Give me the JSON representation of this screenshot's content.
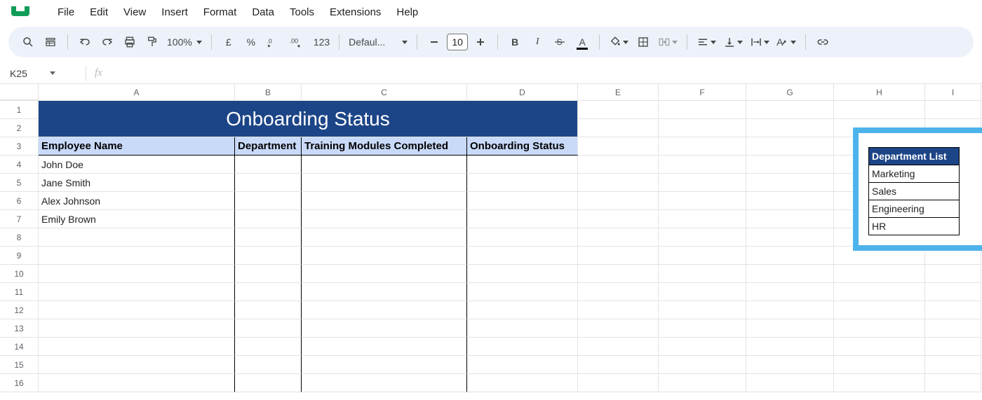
{
  "menu": {
    "items": [
      "File",
      "Edit",
      "View",
      "Insert",
      "Format",
      "Data",
      "Tools",
      "Extensions",
      "Help"
    ]
  },
  "toolbar": {
    "zoom": "100%",
    "currency": "£",
    "percent": "%",
    "dec_decrease": ".0",
    "dec_increase": ".00",
    "format_123": "123",
    "font_name": "Defaul...",
    "font_size": "10",
    "bold": "B",
    "italic": "I",
    "text_color_letter": "A",
    "text_color_drop": "A"
  },
  "name_box": {
    "ref": "K25",
    "fx_label": "fx",
    "formula": ""
  },
  "columns": [
    "A",
    "B",
    "C",
    "D",
    "E",
    "F",
    "G",
    "H",
    "I"
  ],
  "rows": [
    "1",
    "2",
    "3",
    "4",
    "5",
    "6",
    "7",
    "8",
    "9",
    "10",
    "11",
    "12",
    "13",
    "14",
    "15",
    "16"
  ],
  "sheet": {
    "title": "Onboarding Status",
    "headers": {
      "A": "Employee Name",
      "B": "Department",
      "C": "Training Modules Completed",
      "D": "Onboarding Status"
    },
    "data": [
      {
        "name": "John Doe"
      },
      {
        "name": "Jane Smith"
      },
      {
        "name": "Alex Johnson"
      },
      {
        "name": "Emily Brown"
      }
    ]
  },
  "dept_list": {
    "header": "Department List",
    "items": [
      "Marketing",
      "Sales",
      "Engineering",
      "HR"
    ]
  }
}
